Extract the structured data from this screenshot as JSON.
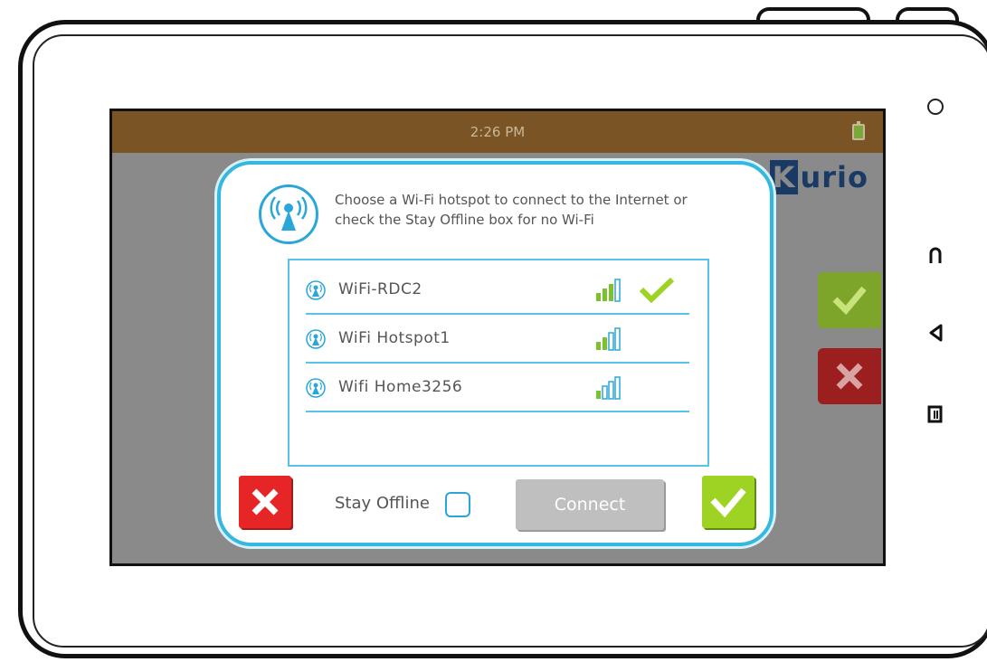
{
  "status_bar": {
    "time": "2:26 PM"
  },
  "brand": {
    "logo_k": "K",
    "logo_rest": "urio"
  },
  "dialog": {
    "prompt_line1": "Choose a Wi-Fi hotspot to connect to the Internet or",
    "prompt_line2": "check the Stay Offline box for no Wi-Fi",
    "networks": [
      {
        "name": "WiFi-RDC2",
        "signal_bars": 3,
        "selected": true
      },
      {
        "name": "WiFi Hotspot1",
        "signal_bars": 2,
        "selected": false
      },
      {
        "name": "Wifi Home3256",
        "signal_bars": 1,
        "selected": false
      }
    ],
    "stay_offline_label": "Stay Offline",
    "stay_offline_checked": false,
    "connect_label": "Connect"
  },
  "colors": {
    "accent": "#34b8df",
    "status_bar": "#7a5424",
    "ok_green": "#9ed324",
    "cancel_red": "#e52526",
    "signal_green": "#7cc22e"
  },
  "icons": {
    "dialog": "wifi-antenna-icon",
    "network": "wifi-antenna-icon",
    "selected": "checkmark-icon",
    "ok": "checkmark-icon",
    "cancel": "close-icon"
  }
}
